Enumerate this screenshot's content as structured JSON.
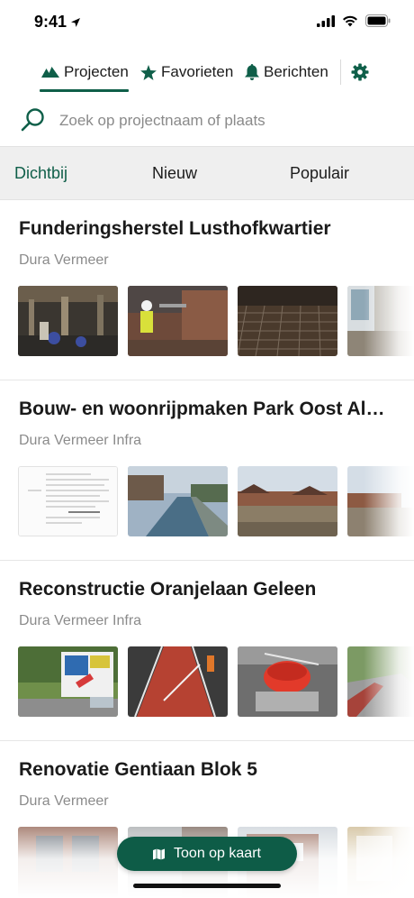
{
  "status": {
    "time": "9:41"
  },
  "nav": {
    "tabs": [
      {
        "label": "Projecten",
        "icon": "mountains-icon"
      },
      {
        "label": "Favorieten",
        "icon": "star-icon"
      },
      {
        "label": "Berichten",
        "icon": "bell-icon"
      }
    ],
    "settings_icon": "gear-icon"
  },
  "search": {
    "placeholder": "Zoek op projectnaam of plaats"
  },
  "filters": [
    {
      "label": "Dichtbij",
      "active": true
    },
    {
      "label": "Nieuw",
      "active": false
    },
    {
      "label": "Populair",
      "active": false
    }
  ],
  "projects": [
    {
      "title": "Funderingsherstel Lusthofkwartier",
      "company": "Dura Vermeer"
    },
    {
      "title": "Bouw- en woonrijpmaken Park Oost Alphen",
      "company": "Dura Vermeer Infra"
    },
    {
      "title": "Reconstructie Oranjelaan Geleen",
      "company": "Dura Vermeer Infra"
    },
    {
      "title": "Renovatie Gentiaan Blok 5",
      "company": "Dura Vermeer"
    }
  ],
  "map_button": {
    "label": "Toon op kaart",
    "icon": "map-icon"
  },
  "colors": {
    "accent": "#0f5f49",
    "button": "#0e5c47"
  }
}
